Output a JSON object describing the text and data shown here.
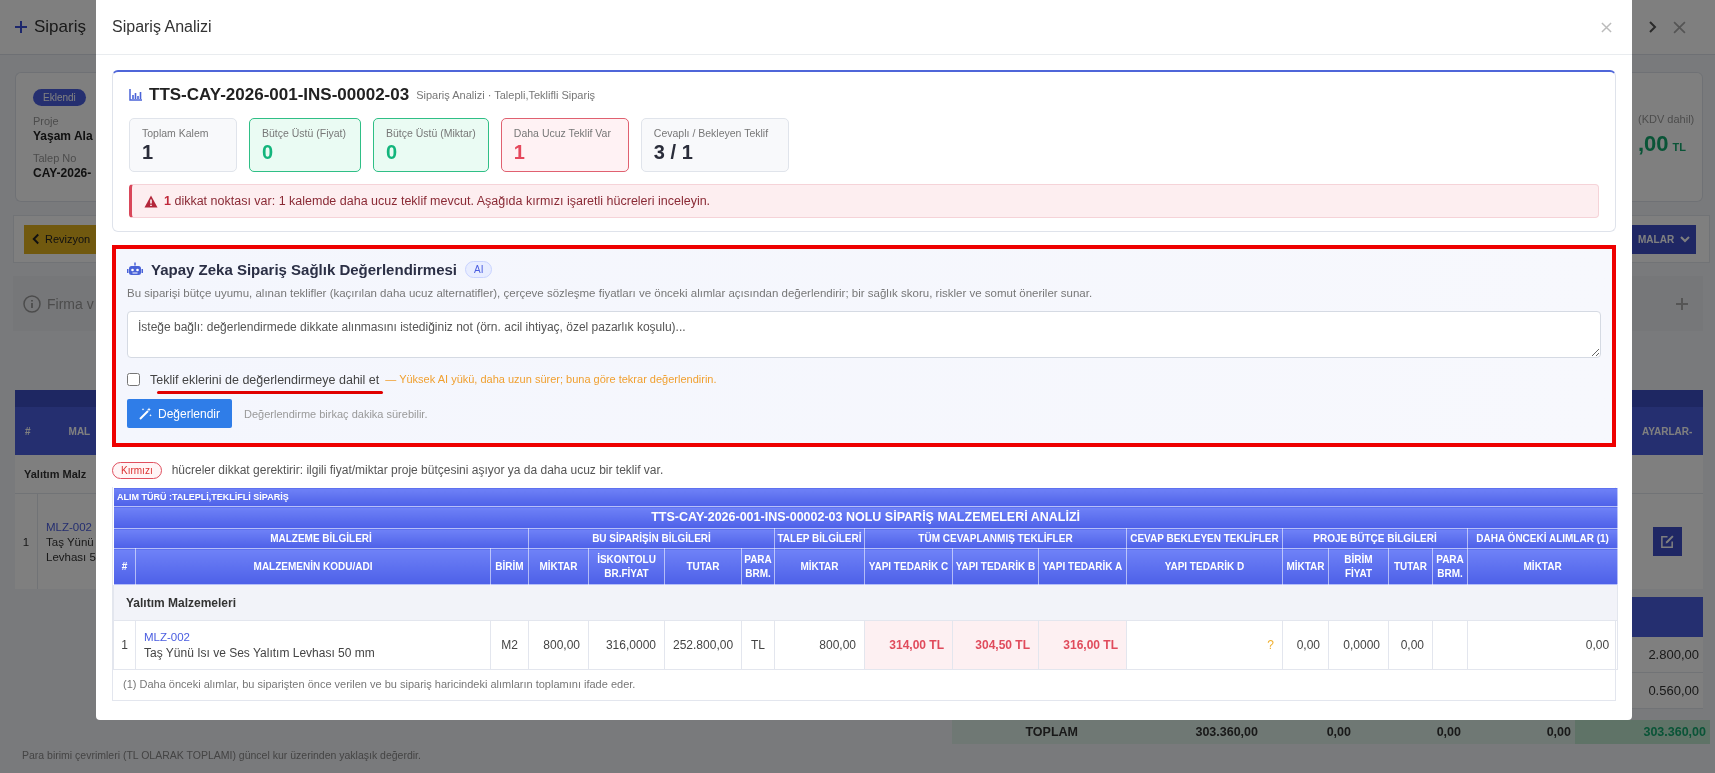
{
  "background": {
    "title": "Sipariş",
    "status_badge": "Eklendi",
    "fields": [
      {
        "label": "Proje",
        "value": "Yaşam Ala"
      },
      {
        "label": "Talep No",
        "value": "CAY-2026-"
      }
    ],
    "revision_button": "Revizyon",
    "section_title": "Firma v",
    "table_header": [
      "#",
      "MAL"
    ],
    "category": "Yalıtım Malz",
    "row": {
      "no": "1",
      "code": "MLZ-002",
      "name_lines": [
        "Taş Yünü",
        "Levhası 5"
      ]
    },
    "total_note": "(KDV dahil)",
    "total_value": ",00",
    "total_currency": "TL",
    "actions_button": "MALAR",
    "settings_header": "AYARLAR-",
    "side_values": [
      "2.800,00",
      "0.560,00"
    ],
    "totals": {
      "label": "TOPLAM",
      "values": [
        "303.360,00",
        "0,00",
        "0,00",
        "0,00"
      ],
      "grand_total": "303.360,00"
    },
    "footnote": "Para birimi çevrimleri (TL OLARAK TOPLAMI) güncel kur üzerinden yaklaşık değerdir."
  },
  "modal": {
    "title": "Sipariş Analizi",
    "summary": {
      "order_no": "TTS-CAY-2026-001-INS-00002-03",
      "subtitle": "Sipariş Analizi · Talepli,Teklifli Sipariş",
      "stats": [
        {
          "label": "Toplam Kalem",
          "value": "1",
          "kind": "neutral"
        },
        {
          "label": "Bütçe Üstü (Fiyat)",
          "value": "0",
          "kind": "ok"
        },
        {
          "label": "Bütçe Üstü (Miktar)",
          "value": "0",
          "kind": "ok"
        },
        {
          "label": "Daha Ucuz Teklif Var",
          "value": "1",
          "kind": "alert"
        },
        {
          "label": "Cevaplı / Bekleyen Teklif",
          "value": "3 / 1",
          "kind": "neutral"
        }
      ],
      "alert": "**1** dikkat noktası var: 1 kalemde daha ucuz teklif mevcut. Aşağıda kırmızı işaretli hücreleri inceleyin."
    },
    "ai": {
      "highlighted": true,
      "title": "Yapay Zeka Sipariş Sağlık Değerlendirmesi",
      "badge": "AI",
      "description": "Bu siparişi bütçe uyumu, alınan teklifler (kaçırılan daha ucuz alternatifler), çerçeve sözleşme fiyatları ve önceki alımlar açısından değerlendirir; bir sağlık skoru, riskler ve somut öneriler sunar.",
      "placeholder": "İsteğe bağlı: değerlendirmede dikkate alınmasını istediğiniz not (örn. acil ihtiyaç, özel pazarlık koşulu)...",
      "include_attachments": {
        "label": "Teklif eklerini de değerlendirmeye dahil et",
        "checked": false,
        "underlined": true,
        "warning": "— Yüksek AI yükü, daha uzun sürer; buna göre tekrar değerlendirin."
      },
      "button": "Değerlendir",
      "hint": "Değerlendirme birkaç dakika sürebilir."
    },
    "legend": {
      "tag": "Kırmızı",
      "text": "hücreler dikkat gerektirir: ilgili fiyat/miktar proje bütçesini aşıyor ya da daha ucuz bir teklif var."
    },
    "table": {
      "purchase_type": "ALIM TÜRÜ :TALEPLİ,TEKLİFLİ SİPARİŞ",
      "title": "TTS-CAY-2026-001-INS-00002-03 NOLU SİPARİŞ MALZEMELERİ ANALİZİ",
      "groups": [
        {
          "label": "MALZEME BİLGİLERİ",
          "columns": [
            "#",
            "MALZEMENİN KODU/ADI",
            "BİRİM"
          ]
        },
        {
          "label": "BU SİPARİŞİN BİLGİLERİ",
          "columns": [
            "MİKTAR",
            "İSKONTOLU BR.FİYAT",
            "TUTAR",
            "PARA BRM."
          ]
        },
        {
          "label": "TALEP BİLGİLERİ",
          "columns": [
            "MİKTAR"
          ]
        },
        {
          "label": "TÜM CEVAPLANMIŞ TEKLİFLER",
          "columns": [
            "YAPI TEDARİK C",
            "YAPI TEDARİK B",
            "YAPI TEDARİK A"
          ]
        },
        {
          "label": "CEVAP BEKLEYEN TEKLİFLER",
          "columns": [
            "YAPI TEDARİK D"
          ]
        },
        {
          "label": "PROJE BÜTÇE BİLGİLERİ",
          "columns": [
            "MİKTAR",
            "BİRİM FİYAT",
            "TUTAR",
            "PARA BRM."
          ]
        },
        {
          "label": "DAHA ÖNCEKİ ALIMLAR (1)",
          "columns": [
            "MİKTAR"
          ]
        }
      ],
      "categories": [
        {
          "name": "Yalıtım Malzemeleri",
          "rows": [
            {
              "no": "1",
              "code": "MLZ-002",
              "name": "Taş Yünü Isı ve Ses Yalıtım Levhası 50 mm",
              "unit": "M2",
              "cells": [
                {
                  "text": "800,00",
                  "kind": "number",
                  "flagged": false
                },
                {
                  "text": "316,0000",
                  "kind": "number",
                  "flagged": false
                },
                {
                  "text": "252.800,00",
                  "kind": "number",
                  "flagged": false
                },
                {
                  "text": "TL",
                  "kind": "text",
                  "flagged": false
                },
                {
                  "text": "800,00",
                  "kind": "number",
                  "flagged": false
                },
                {
                  "text": "314,00 TL",
                  "kind": "offer",
                  "flagged": true
                },
                {
                  "text": "304,50 TL",
                  "kind": "offer",
                  "flagged": true
                },
                {
                  "text": "316,00 TL",
                  "kind": "offer",
                  "flagged": true
                },
                {
                  "text": "?",
                  "kind": "pending",
                  "flagged": false
                },
                {
                  "text": "0,00",
                  "kind": "number",
                  "flagged": false
                },
                {
                  "text": "0,0000",
                  "kind": "number",
                  "flagged": false
                },
                {
                  "text": "0,00",
                  "kind": "number",
                  "flagged": false
                },
                {
                  "kind": "empty",
                  "flagged": false
                },
                {
                  "text": "0,00",
                  "kind": "number",
                  "flagged": false
                }
              ]
            }
          ]
        }
      ],
      "footnote": "(1) Daha önceki alımlar, bu siparişten önce verilen ve bu sipariş haricindeki alımların toplamını ifade eder."
    }
  }
}
